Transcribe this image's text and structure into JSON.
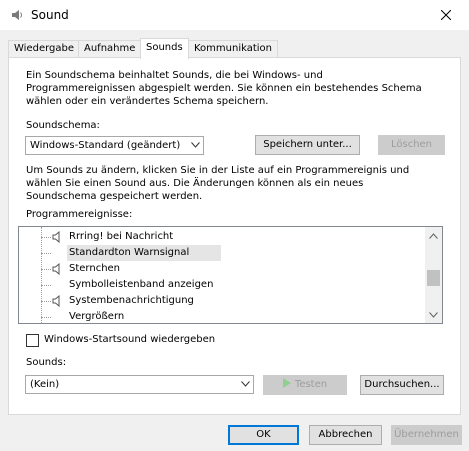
{
  "window": {
    "title": "Sound",
    "close_label": "×"
  },
  "tabs": [
    {
      "label": "Wiedergabe",
      "active": false
    },
    {
      "label": "Aufnahme",
      "active": false
    },
    {
      "label": "Sounds",
      "active": true
    },
    {
      "label": "Kommunikation",
      "active": false
    }
  ],
  "description": {
    "line1": "Ein Soundschema beinhaltet Sounds, die bei Windows- und",
    "line2": "Programmereignissen abgespielt werden. Sie können ein bestehendes Schema",
    "line3": "wählen oder ein verändertes Schema speichern."
  },
  "scheme": {
    "label": "Soundschema:",
    "selected": "Windows-Standard (geändert)",
    "save_button": "Speichern unter...",
    "delete_button": "Löschen"
  },
  "instructions": {
    "line1": "Um Sounds zu ändern, klicken Sie in der Liste auf ein Programmereignis und",
    "line2": "wählen Sie einen Sound aus. Die Änderungen können als ein neues",
    "line3": "Soundschema gespeichert werden."
  },
  "events": {
    "label": "Programmereignisse:",
    "items": [
      {
        "label": "Rrring! bei Nachricht",
        "has_sound": true,
        "selected": false
      },
      {
        "label": "Standardton Warnsignal",
        "has_sound": false,
        "selected": true
      },
      {
        "label": "Sternchen",
        "has_sound": true,
        "selected": false
      },
      {
        "label": "Symbolleistenband anzeigen",
        "has_sound": false,
        "selected": false
      },
      {
        "label": "Systembenachrichtigung",
        "has_sound": true,
        "selected": false
      },
      {
        "label": "Vergrößern",
        "has_sound": false,
        "selected": false
      }
    ]
  },
  "startup": {
    "label": "Windows-Startsound wiedergeben",
    "checked": false
  },
  "sounds": {
    "label": "Sounds:",
    "selected": "(Kein)",
    "test_button": "Testen",
    "browse_button": "Durchsuchen..."
  },
  "footer": {
    "ok": "OK",
    "cancel": "Abbrechen",
    "apply": "Übernehmen"
  }
}
